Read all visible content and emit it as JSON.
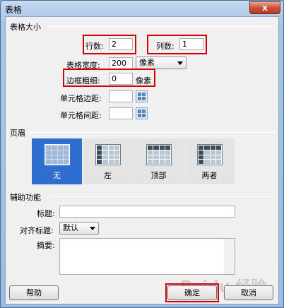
{
  "window": {
    "title": "表格",
    "close_glyph": "x"
  },
  "table_size": {
    "section_label": "表格大小",
    "rows_label": "行数:",
    "rows_value": "2",
    "cols_label": "列数:",
    "cols_value": "1",
    "width_label": "表格宽度:",
    "width_value": "200",
    "width_unit": "像素",
    "border_label": "边框粗细:",
    "border_value": "0",
    "border_unit": "像素",
    "padding_label": "单元格边距:",
    "padding_value": "",
    "spacing_label": "单元格间距:",
    "spacing_value": ""
  },
  "header": {
    "section_label": "页眉",
    "options": [
      {
        "label": "无",
        "selected": true
      },
      {
        "label": "左",
        "selected": false
      },
      {
        "label": "顶部",
        "selected": false
      },
      {
        "label": "两者",
        "selected": false
      }
    ]
  },
  "accessibility": {
    "section_label": "辅助功能",
    "caption_label": "标题:",
    "caption_value": "",
    "align_label": "对齐标题:",
    "align_value": "默认",
    "summary_label": "摘要:",
    "summary_value": ""
  },
  "buttons": {
    "help": "帮助",
    "ok": "确定",
    "cancel": "取消"
  },
  "watermark": "Baidu 经验",
  "colors": {
    "highlight": "#d40000",
    "selected": "#2f6ecf"
  }
}
